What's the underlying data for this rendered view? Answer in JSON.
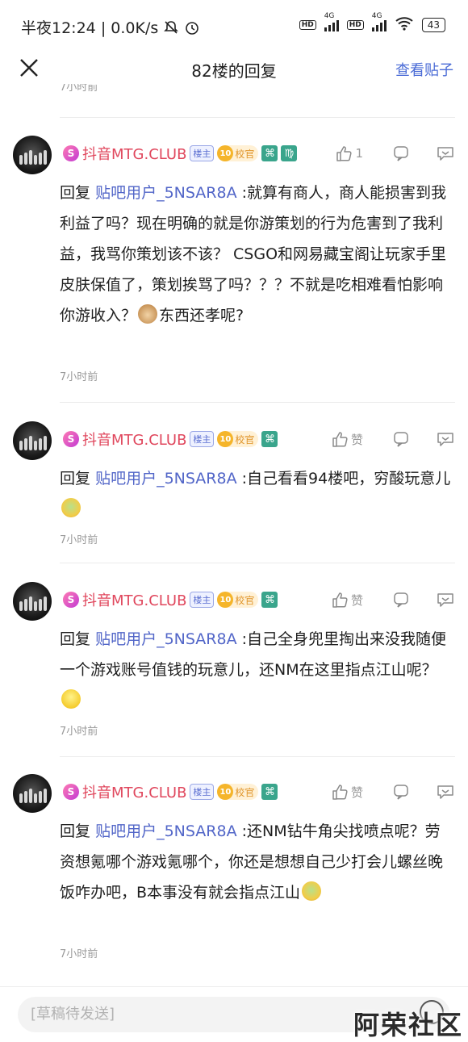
{
  "status_bar": {
    "time": "半夜12:24",
    "speed": "0.0K/s",
    "network1": "4G",
    "network2": "4G",
    "battery": "43"
  },
  "nav": {
    "title": "82楼的回复",
    "view_post": "查看贴子"
  },
  "prev_time": "7小时前",
  "posts": [
    {
      "username": "抖音MTG.CLUB",
      "owner_badge": "楼主",
      "level": "10",
      "level_label": "校官",
      "like_label": "1",
      "reply_prefix": "回复",
      "mention": "贴吧用户_5NSAR8A",
      "text_before_emoji": ":就算有商人，商人能损害到我利益了吗？现在明确的就是你游策划的行为危害到了我利益，我骂你策划该不该？ CSGO和网易藏宝阁让玩家手里皮肤保值了，策划挨骂了吗？？？不就是吃相难看怕影响你游收入？",
      "emoji": "dog-emoji",
      "text_after_emoji": "东西还孝呢?",
      "time": "7小时前"
    },
    {
      "username": "抖音MTG.CLUB",
      "owner_badge": "楼主",
      "level": "10",
      "level_label": "校官",
      "like_label": "赞",
      "reply_prefix": "回复",
      "mention": "贴吧用户_5NSAR8A",
      "text_before_emoji": ":自己看看94楼吧，穷酸玩意儿",
      "emoji": "sick-emoji",
      "text_after_emoji": "",
      "time": "7小时前"
    },
    {
      "username": "抖音MTG.CLUB",
      "owner_badge": "楼主",
      "level": "10",
      "level_label": "校官",
      "like_label": "赞",
      "reply_prefix": "回复",
      "mention": "贴吧用户_5NSAR8A",
      "text_before_emoji": ":自己全身兜里掏出来没我随便一个游戏账号值钱的玩意儿，还NM在这里指点江山呢？",
      "emoji": "smile-emoji",
      "text_after_emoji": "",
      "time": "7小时前"
    },
    {
      "username": "抖音MTG.CLUB",
      "owner_badge": "楼主",
      "level": "10",
      "level_label": "校官",
      "like_label": "赞",
      "reply_prefix": "回复",
      "mention": "贴吧用户_5NSAR8A",
      "text_before_emoji": ":还NM钻牛角尖找喷点呢？劳资想氪哪个游戏氪哪个，你还是想想自己少打会儿螺丝晚饭咋办吧，B本事没有就会指点江山",
      "emoji": "sick-emoji",
      "text_after_emoji": "",
      "time": "7小时前"
    }
  ],
  "bottom": {
    "draft_placeholder": "[草稿待发送]"
  },
  "watermark": "阿荣社区",
  "colors": {
    "username": "#e0475d",
    "mention": "#5266c8",
    "link": "#4a6bd6"
  }
}
